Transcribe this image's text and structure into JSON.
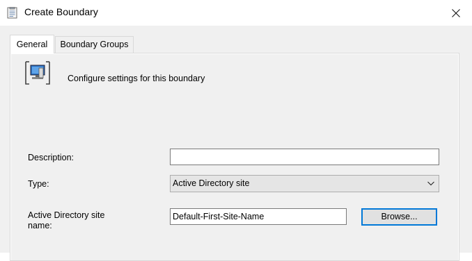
{
  "window": {
    "title": "Create Boundary",
    "title_icon": "document-form-icon",
    "close_icon": "close-icon"
  },
  "tabs": [
    {
      "label": "General",
      "active": true
    },
    {
      "label": "Boundary Groups",
      "active": false
    }
  ],
  "general": {
    "header_icon": "computer-boundary-icon",
    "header_text": "Configure settings for this boundary",
    "description_label": "Description:",
    "description_value": "",
    "type_label": "Type:",
    "type_value": "Active Directory site",
    "site_name_label_line1": "Active Directory site",
    "site_name_label_line2": "name:",
    "site_name_value": "Default-First-Site-Name",
    "browse_label": "Browse..."
  },
  "colors": {
    "dialog_background": "#f0f0f0",
    "accent": "#0078d7"
  }
}
